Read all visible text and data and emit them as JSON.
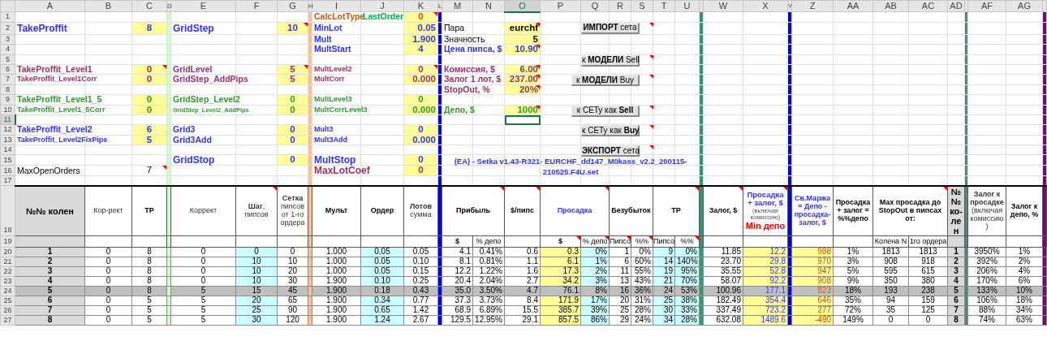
{
  "columns": [
    {
      "label": "A",
      "selected": false
    },
    {
      "label": "B",
      "selected": false
    },
    {
      "label": "C",
      "selected": false
    },
    {
      "label": "D",
      "selected": false
    },
    {
      "label": "E",
      "selected": false
    },
    {
      "label": "F",
      "selected": false
    },
    {
      "label": "G",
      "selected": false
    },
    {
      "label": "H",
      "selected": false
    },
    {
      "label": "I",
      "selected": false
    },
    {
      "label": "J",
      "selected": false
    },
    {
      "label": "K",
      "selected": false
    },
    {
      "label": "L",
      "selected": false
    },
    {
      "label": "M",
      "selected": false
    },
    {
      "label": "N",
      "selected": false
    },
    {
      "label": "O",
      "selected": true
    },
    {
      "label": "P",
      "selected": false
    },
    {
      "label": "Q",
      "selected": false
    },
    {
      "label": "R",
      "selected": false
    },
    {
      "label": "S",
      "selected": false
    },
    {
      "label": "T",
      "selected": false
    },
    {
      "label": "U",
      "selected": false
    },
    {
      "selected": false
    },
    {
      "label": "W",
      "selected": false
    },
    {
      "label": "X",
      "selected": false
    },
    {
      "label": "Y",
      "selected": false
    },
    {
      "label": "Z",
      "selected": false
    },
    {
      "label": "AA",
      "selected": false
    },
    {
      "label": "AB",
      "selected": false
    },
    {
      "label": "AC",
      "selected": false
    },
    {
      "label": "AD",
      "selected": false
    },
    {
      "selected": false
    },
    {
      "label": "AF",
      "selected": false
    },
    {
      "label": "AG",
      "selected": false
    },
    {
      "selected": false
    }
  ],
  "rows": [
    {
      "number": "1",
      "selected": false,
      "I": {
        "text": "CalcLotType",
        "kind": "label",
        "color": "#c55a11"
      },
      "J": {
        "text": "LastOrder",
        "kind": "label",
        "color": "#00b050"
      },
      "K": {
        "text": "0",
        "kind": "input",
        "note": true
      }
    },
    {
      "number": "2",
      "selected": false,
      "A": {
        "text": "TakeProffit",
        "kind": "title",
        "color": "#3333ff"
      },
      "C": {
        "text": "8",
        "kind": "input"
      },
      "E": {
        "text": "GridStep",
        "kind": "title",
        "color": "#3333ff"
      },
      "G": {
        "text": "10",
        "kind": "input",
        "note": true
      },
      "I": {
        "text": "MinLot",
        "kind": "label",
        "color": "#3333ff"
      },
      "K": {
        "text": "0.05",
        "kind": "input-right"
      },
      "M": {
        "text": "Пара",
        "kind": "plain"
      },
      "O": {
        "text": "eurchf",
        "kind": "input-right",
        "note": true
      },
      "Q": {
        "text": "**ИМПОРТ** сета",
        "kind": "button",
        "note": true
      }
    },
    {
      "number": "3",
      "selected": false,
      "I": {
        "text": "Mult",
        "kind": "label",
        "color": "#3333ff"
      },
      "K": {
        "text": "1.900",
        "kind": "input-right"
      },
      "M": {
        "text": "Значность",
        "kind": "plain"
      },
      "O": {
        "text": "5",
        "kind": "input-right"
      }
    },
    {
      "number": "4",
      "selected": false,
      "I": {
        "text": "MultStart",
        "kind": "label",
        "color": "#3333ff"
      },
      "K": {
        "text": "4",
        "kind": "input"
      },
      "M": {
        "text": "Цена пипса, $",
        "kind": "label",
        "color": "#3333ff"
      },
      "O": {
        "text": "10.90",
        "kind": "input-right",
        "note": true
      }
    },
    {
      "number": "5",
      "selected": false,
      "Q": {
        "text": "к **МОДЕЛИ** Sell",
        "kind": "button",
        "note": true
      }
    },
    {
      "number": "6",
      "selected": false,
      "A": {
        "text": "TakeProffit_Level1",
        "kind": "label",
        "color": "#993366"
      },
      "C": {
        "text": "0",
        "kind": "input",
        "note": true
      },
      "E": {
        "text": "GridLevel",
        "kind": "label",
        "color": "#993366"
      },
      "G": {
        "text": "5",
        "kind": "input",
        "note": true
      },
      "I": {
        "text": "MultLevel2",
        "kind": "small",
        "color": "#993366"
      },
      "K": {
        "text": "0",
        "kind": "input",
        "note": true
      },
      "M": {
        "text": "Комиссия, $",
        "kind": "label",
        "color": "#993366"
      },
      "O": {
        "text": "6.00",
        "kind": "input-right",
        "note": true
      }
    },
    {
      "number": "7",
      "selected": false,
      "A": {
        "text": "TakeProffit_Level1Corr",
        "kind": "small",
        "color": "#993366"
      },
      "C": {
        "text": "0",
        "kind": "input"
      },
      "E": {
        "text": "GridStep_AddPips",
        "kind": "label",
        "color": "#993366"
      },
      "G": {
        "text": "5",
        "kind": "input"
      },
      "I": {
        "text": "MultCorr",
        "kind": "small",
        "color": "#993366"
      },
      "K": {
        "text": "0.000",
        "kind": "input-right"
      },
      "M": {
        "text": "Залог 1 лот, $",
        "kind": "label",
        "color": "#993366"
      },
      "O": {
        "text": "237.00",
        "kind": "input-right",
        "note": true
      },
      "P": {
        "text": "к **МОДЕЛИ** Buy",
        "kind": "button",
        "note": true
      }
    },
    {
      "number": "8",
      "selected": false,
      "M": {
        "text": "StopOut, %",
        "kind": "label",
        "color": "#993366"
      },
      "O": {
        "text": "20%",
        "kind": "input-right",
        "note": true
      }
    },
    {
      "number": "9",
      "selected": false,
      "A": {
        "text": "TakeProffit_Level1_5",
        "kind": "label",
        "color": "#339933"
      },
      "C": {
        "text": "0",
        "kind": "input"
      },
      "E": {
        "text": "GridStep_Level2",
        "kind": "label",
        "color": "#339933"
      },
      "G": {
        "text": "0",
        "kind": "input"
      },
      "I": {
        "text": "MultLevel3",
        "kind": "small",
        "color": "#339933"
      },
      "K": {
        "text": "0",
        "kind": "input"
      }
    },
    {
      "number": "10",
      "selected": false,
      "A": {
        "text": "TakeProffit_Level1_5Corr",
        "kind": "small",
        "color": "#339933"
      },
      "C": {
        "text": "0",
        "kind": "input"
      },
      "E": {
        "text": "GridStep_Level2_AddPips",
        "kind": "tiny",
        "color": "#339933"
      },
      "G": {
        "text": "0",
        "kind": "input"
      },
      "I": {
        "text": "MultCorrLevel3",
        "kind": "small",
        "color": "#339933"
      },
      "K": {
        "text": "0.000",
        "kind": "input-right"
      },
      "M": {
        "text": "Депо, $",
        "kind": "label",
        "color": "#339933"
      },
      "O": {
        "text": "1000",
        "kind": "input-right",
        "note": true
      },
      "P": {
        "text": "к СЕТу как **Sell**",
        "kind": "button",
        "note": true
      }
    },
    {
      "number": "11",
      "selected": true
    },
    {
      "number": "12",
      "selected": false,
      "A": {
        "text": "TakeProffit_Level2",
        "kind": "label",
        "color": "#3333ff"
      },
      "C": {
        "text": "6",
        "kind": "input"
      },
      "E": {
        "text": "Grid3",
        "kind": "label",
        "color": "#3333ff"
      },
      "G": {
        "text": "0",
        "kind": "input"
      },
      "I": {
        "text": "Mult3",
        "kind": "small",
        "color": "#3333ff"
      },
      "K": {
        "text": "0",
        "kind": "input"
      },
      "Q": {
        "text": "к СЕТу как **Buy**",
        "kind": "button",
        "note": true
      }
    },
    {
      "number": "13",
      "selected": false,
      "A": {
        "text": "TakeProffit_Level2FixPips",
        "kind": "small",
        "color": "#3333ff"
      },
      "C": {
        "text": "5",
        "kind": "input"
      },
      "E": {
        "text": "Grid3Add",
        "kind": "label",
        "color": "#3333ff"
      },
      "G": {
        "text": "0",
        "kind": "input"
      },
      "I": {
        "text": "Mult3Add",
        "kind": "small",
        "color": "#3333ff"
      },
      "K": {
        "text": "0.000",
        "kind": "input-right"
      }
    },
    {
      "number": "14",
      "selected": false,
      "Q": {
        "text": "**ЭКСПОРТ** сета",
        "kind": "button",
        "note": true
      }
    },
    {
      "number": "15",
      "selected": false,
      "E": {
        "text": "GridStop",
        "kind": "title",
        "color": "#3333ff"
      },
      "G": {
        "text": "0",
        "kind": "input"
      },
      "I": {
        "text": "MultStop",
        "kind": "title",
        "color": "#3333ff"
      },
      "K": {
        "text": "0",
        "kind": "input"
      },
      "M": {
        "text": "(EA) - Setka v1.43-R321- EURCHF_dd147_M0kass_v2.2_200115-210525.F4U.set",
        "kind": "filename",
        "color": "#3333ff"
      }
    },
    {
      "number": "16",
      "selected": false,
      "A": {
        "text": "MaxOpenOrders",
        "kind": "plain"
      },
      "C": {
        "text": "7",
        "kind": "value",
        "note": true
      },
      "I": {
        "text": "MaxLotCoef",
        "kind": "title",
        "color": "#993366"
      },
      "K": {
        "text": "0",
        "kind": "input"
      }
    },
    {
      "number": "17",
      "selected": false
    }
  ],
  "table": {
    "header": {
      "number": "18",
      "selected": false,
      "A": {
        "text": "№№ колен",
        "kind": "gray"
      },
      "B": {
        "text": "Кор-рект",
        "kind": "light"
      },
      "C": {
        "text": "TP",
        "kind": "head"
      },
      "E": {
        "text": "Коррект",
        "kind": "light"
      },
      "F": {
        "text": "**Шаг**, пипсов",
        "kind": "light",
        "note": true
      },
      "G": {
        "text": "**Сетка** пипсов от 1-го ордера",
        "kind": "light"
      },
      "I": {
        "text": "Мульт",
        "kind": "head"
      },
      "J": {
        "text": "Ордер",
        "kind": "head"
      },
      "K": {
        "text": "**Лотов** сумма",
        "kind": "light"
      },
      "M": {
        "text": "Прибыль",
        "kind": "head",
        "note": true
      },
      "O": {
        "text": "$/пипс",
        "kind": "head",
        "note": true
      },
      "P": {
        "text": "Просадка",
        "kind": "head-blue",
        "note": true
      },
      "R": {
        "text": "Безубыток",
        "kind": "head"
      },
      "T": {
        "text": "TP",
        "kind": "head",
        "note": true
      },
      "W": {
        "text": "Залог, $",
        "kind": "head",
        "note": true
      },
      "X": {
        "lines": [
          {
            "text": "Просадка + залог, $",
            "kind": "blue"
          },
          {
            "text": "(включая комиссию)",
            "kind": "note"
          },
          {
            "text": "Min депо",
            "kind": "alert"
          }
        ],
        "note": true
      },
      "Z": {
        "text": "Св.Маржа = Депо - просадка-залог, $",
        "kind": "head-blue"
      },
      "AA": {
        "text": "Просадка + залог = %%депо",
        "kind": "head"
      },
      "AB": {
        "text": "Max просадка до StopOut в пипсах от:",
        "kind": "head",
        "note": true
      },
      "AD": {
        "text": "№ № ко-лен",
        "kind": "gray"
      },
      "AF": {
        "text": "**Залог к просадке** (включая комиссию)",
        "kind": "light"
      },
      "AG": {
        "text": "Залог к депо, %",
        "kind": "head"
      }
    },
    "subheader": {
      "number": "19",
      "selected": false,
      "M": {
        "text": "$",
        "kind": "head"
      },
      "N": {
        "text": "% депо",
        "kind": "plain"
      },
      "P": {
        "text": "$",
        "kind": "head",
        "note": true
      },
      "Q": {
        "text": "% депо",
        "kind": "plain",
        "note": true
      },
      "R": {
        "text": "Пипсо",
        "kind": "plain",
        "note": true
      },
      "S": {
        "text": "%%",
        "kind": "plain",
        "note": true
      },
      "T": {
        "text": "Пипсо",
        "kind": "plain"
      },
      "U": {
        "text": "%%",
        "kind": "plain",
        "note": true
      },
      "AB": {
        "text": "Колена N",
        "kind": "plain"
      },
      "AC": {
        "text": "1го ордера",
        "kind": "plain"
      }
    },
    "rows": [
      {
        "number": "20",
        "selected": false,
        "highlighted": false,
        "margin_negative": false,
        "cells": [
          "1",
          "0",
          "8",
          "0",
          "0",
          "0",
          "1.000",
          "0.05",
          "0.05",
          "4.1",
          "0.41%",
          "0.6",
          "0.3",
          "0%",
          "1",
          "0%",
          "9",
          "0%",
          "11.85",
          "12.2",
          "988",
          "1%",
          "1813",
          "1813",
          "1",
          "3950%",
          "1%"
        ]
      },
      {
        "number": "21",
        "selected": false,
        "highlighted": false,
        "margin_negative": false,
        "cells": [
          "2",
          "0",
          "8",
          "0",
          "10",
          "10",
          "1.000",
          "0.05",
          "0.10",
          "8.1",
          "0.81%",
          "1.1",
          "6.1",
          "1%",
          "6",
          "60%",
          "14",
          "140%",
          "23.70",
          "29.8",
          "970",
          "3%",
          "908",
          "918",
          "2",
          "392%",
          "2%"
        ]
      },
      {
        "number": "22",
        "selected": false,
        "highlighted": false,
        "margin_negative": false,
        "cells": [
          "3",
          "0",
          "8",
          "0",
          "10",
          "20",
          "1.000",
          "0.05",
          "0.15",
          "12.2",
          "1.22%",
          "1.6",
          "17.3",
          "2%",
          "11",
          "55%",
          "19",
          "95%",
          "35.55",
          "52.8",
          "947",
          "5%",
          "595",
          "615",
          "3",
          "206%",
          "4%"
        ]
      },
      {
        "number": "23",
        "selected": false,
        "highlighted": false,
        "margin_negative": false,
        "cells": [
          "4",
          "0",
          "8",
          "0",
          "10",
          "30",
          "1.900",
          "0.10",
          "0.25",
          "20.4",
          "2.04%",
          "2.7",
          "34.2",
          "3%",
          "13",
          "43%",
          "21",
          "70%",
          "58.07",
          "92.2",
          "908",
          "9%",
          "350",
          "380",
          "4",
          "170%",
          "6%"
        ]
      },
      {
        "number": "24",
        "selected": false,
        "highlighted": true,
        "margin_negative": false,
        "cells": [
          "5",
          "0",
          "8",
          "5",
          "15",
          "45",
          "1.900",
          "0.18",
          "0.43",
          "35.0",
          "3.50%",
          "4.7",
          "76.1",
          "8%",
          "16",
          "36%",
          "24",
          "53%",
          "100.96",
          "177.1",
          "823",
          "18%",
          "193",
          "238",
          "5",
          "133%",
          "10%"
        ]
      },
      {
        "number": "25",
        "selected": false,
        "highlighted": false,
        "margin_negative": false,
        "cells": [
          "6",
          "0",
          "5",
          "5",
          "20",
          "65",
          "1.900",
          "0.34",
          "0.77",
          "37.3",
          "3.73%",
          "8.4",
          "171.9",
          "17%",
          "20",
          "31%",
          "25",
          "38%",
          "182.49",
          "354.4",
          "646",
          "35%",
          "94",
          "159",
          "6",
          "106%",
          "18%"
        ]
      },
      {
        "number": "26",
        "selected": false,
        "highlighted": false,
        "margin_negative": false,
        "cells": [
          "7",
          "0",
          "5",
          "5",
          "25",
          "90",
          "1.900",
          "0.65",
          "1.42",
          "68.9",
          "6.89%",
          "15.5",
          "385.7",
          "39%",
          "25",
          "28%",
          "30",
          "33%",
          "337.49",
          "723.2",
          "277",
          "72%",
          "35",
          "125",
          "7",
          "88%",
          "34%"
        ]
      },
      {
        "number": "27",
        "selected": false,
        "highlighted": false,
        "margin_negative": true,
        "cells": [
          "8",
          "0",
          "5",
          "5",
          "30",
          "120",
          "1.900",
          "1.24",
          "2.67",
          "129.5",
          "12.95%",
          "29.1",
          "857.5",
          "86%",
          "29",
          "24%",
          "34",
          "28%",
          "632.08",
          "1489.6",
          "-490",
          "149%",
          "0",
          "0",
          "8",
          "74%",
          "63%"
        ]
      }
    ]
  }
}
